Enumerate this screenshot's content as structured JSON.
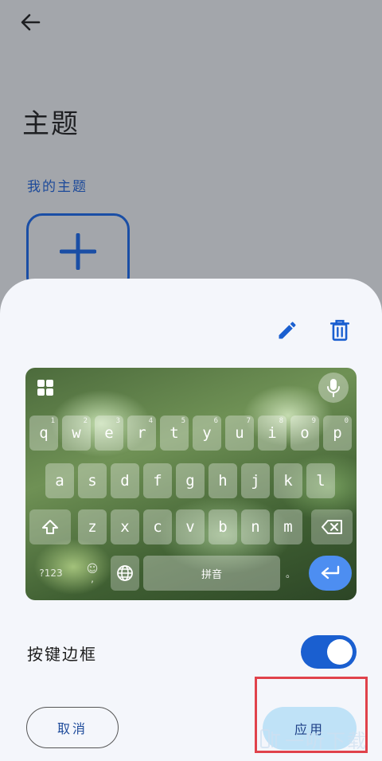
{
  "page": {
    "title": "主题",
    "section_label": "我的主题"
  },
  "sheet": {
    "keyboard": {
      "row1": [
        {
          "char": "q",
          "num": "1"
        },
        {
          "char": "w",
          "num": "2"
        },
        {
          "char": "e",
          "num": "3"
        },
        {
          "char": "r",
          "num": "4"
        },
        {
          "char": "t",
          "num": "5"
        },
        {
          "char": "y",
          "num": "6"
        },
        {
          "char": "u",
          "num": "7"
        },
        {
          "char": "i",
          "num": "8"
        },
        {
          "char": "o",
          "num": "9"
        },
        {
          "char": "p",
          "num": "0"
        }
      ],
      "row2": [
        "a",
        "s",
        "d",
        "f",
        "g",
        "h",
        "j",
        "k",
        "l"
      ],
      "row3": [
        "z",
        "x",
        "c",
        "v",
        "b",
        "n",
        "m"
      ],
      "key_123": "?123",
      "key_emoji": "☺",
      "key_comma": ",",
      "key_space": "拼音",
      "key_period": "。"
    },
    "toggle": {
      "label": "按键边框",
      "state": "on"
    },
    "buttons": {
      "cancel": "取消",
      "apply": "应用"
    }
  },
  "watermark": "一听下载",
  "colors": {
    "accent": "#1a5fd0",
    "apply_bg": "#bfe2f7",
    "highlight": "#e0424b",
    "enter_key": "#4d8ef1"
  },
  "icons": [
    "back-arrow-icon",
    "plus-icon",
    "edit-pencil-icon",
    "delete-trash-icon",
    "grid-menu-icon",
    "microphone-icon",
    "shift-icon",
    "backspace-icon",
    "globe-icon",
    "enter-icon"
  ]
}
